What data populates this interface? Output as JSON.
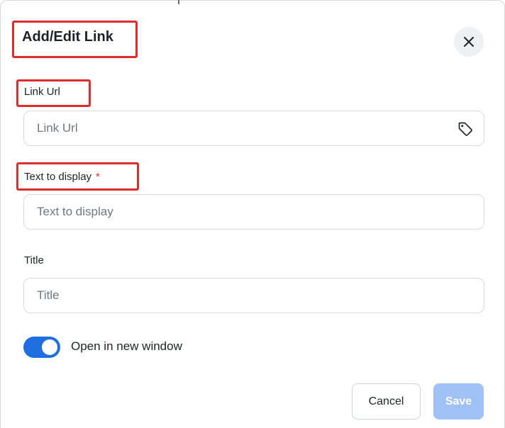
{
  "dialog": {
    "title": "Add/Edit Link"
  },
  "fields": {
    "link_url": {
      "label": "Link Url",
      "value": "",
      "placeholder": "Link Url",
      "icon": "tag-icon"
    },
    "text_to_display": {
      "label": "Text to display",
      "required_mark": "*",
      "value": "",
      "placeholder": "Text to display"
    },
    "title": {
      "label": "Title",
      "value": "",
      "placeholder": "Title"
    }
  },
  "options": {
    "open_new_window": {
      "label": "Open in new window",
      "checked": true
    }
  },
  "actions": {
    "cancel_label": "Cancel",
    "save_label": "Save"
  },
  "colors": {
    "accent": "#1f6fe0",
    "save_disabled": "#9fc1f4",
    "highlight": "#e02b2b",
    "required": "#e02b2b"
  }
}
